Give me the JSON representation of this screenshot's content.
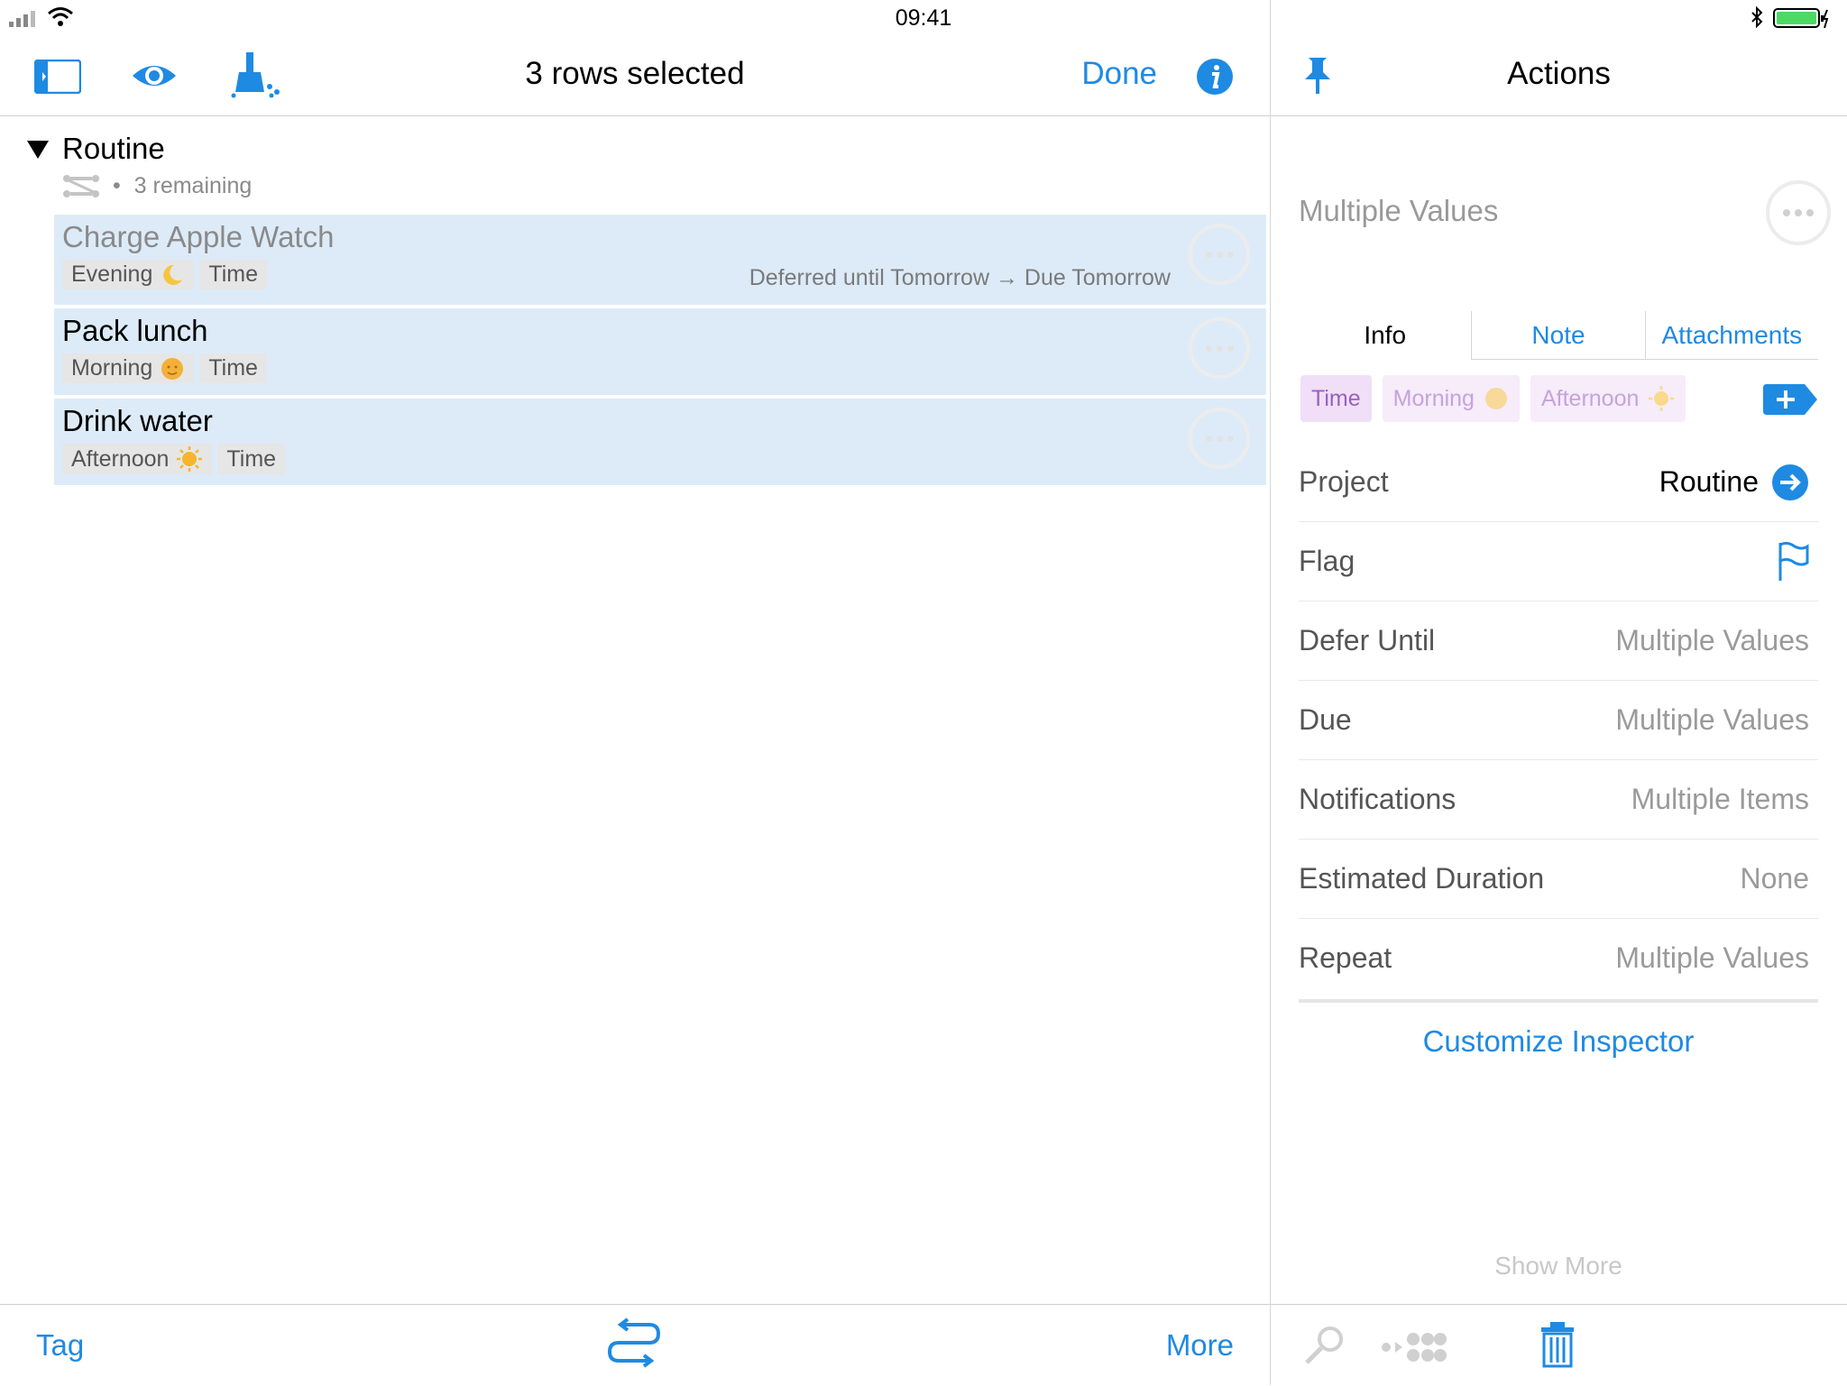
{
  "status_bar": {
    "time": "09:41"
  },
  "navbar": {
    "title": "3 rows selected",
    "done_label": "Done"
  },
  "inspector_nav": {
    "title": "Actions"
  },
  "outline": {
    "project": {
      "title": "Routine",
      "meta": "3 remaining"
    },
    "tasks": [
      {
        "title": "Charge Apple Watch",
        "tags": [
          "Evening",
          "Time"
        ],
        "status": "Deferred until Tomorrow → Due Tomorrow"
      },
      {
        "title": "Pack lunch",
        "tags": [
          "Morning",
          "Time"
        ],
        "status": ""
      },
      {
        "title": "Drink water",
        "tags": [
          "Afternoon",
          "Time"
        ],
        "status": ""
      }
    ]
  },
  "inspector": {
    "header": "Multiple Values",
    "tabs": [
      "Info",
      "Note",
      "Attachments"
    ],
    "chips": [
      "Time",
      "Morning",
      "Afternoon"
    ],
    "fields": [
      {
        "label": "Project",
        "value": "Routine"
      },
      {
        "label": "Flag",
        "value": ""
      },
      {
        "label": "Defer Until",
        "value": "Multiple Values"
      },
      {
        "label": "Due",
        "value": "Multiple Values"
      },
      {
        "label": "Notifications",
        "value": "Multiple Items"
      },
      {
        "label": "Estimated Duration",
        "value": "None"
      },
      {
        "label": "Repeat",
        "value": "Multiple Values"
      }
    ],
    "customize_label": "Customize Inspector",
    "show_more_label": "Show More"
  },
  "toolbar": {
    "tag_label": "Tag",
    "more_label": "More"
  },
  "colors": {
    "accent": "#1f8ae2",
    "selection": "#ddebf8",
    "tag_chip": "#f0dff7"
  },
  "icons": [
    "sidebar-toggle-icon",
    "eye-icon",
    "broom-icon",
    "info-icon",
    "pin-icon",
    "arrow-right-circle-icon",
    "flag-icon",
    "plus-icon",
    "move-icon",
    "tag-cleanup-icon",
    "group-icon",
    "trash-icon"
  ]
}
